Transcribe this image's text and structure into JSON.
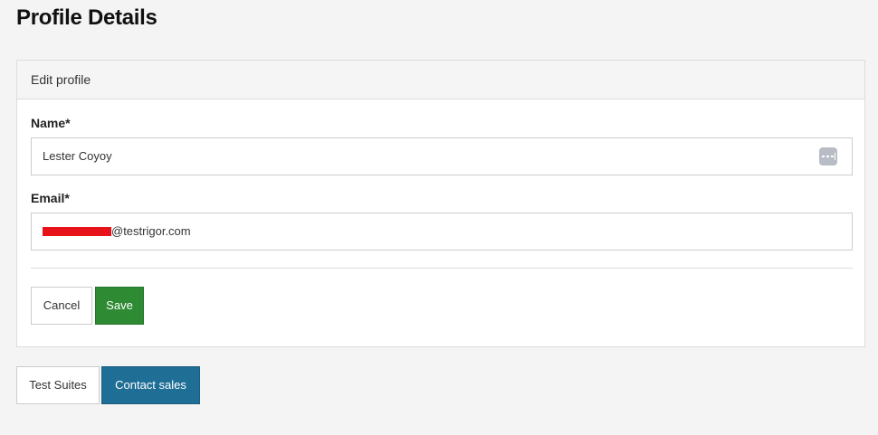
{
  "page": {
    "title": "Profile Details"
  },
  "panel": {
    "header": "Edit profile"
  },
  "form": {
    "name_label": "Name*",
    "name_value": "Lester Coyoy",
    "email_label": "Email*",
    "email_value_visible": "@testrigor.com",
    "email_redacted": true
  },
  "actions": {
    "cancel_label": "Cancel",
    "save_label": "Save"
  },
  "footer": {
    "suites_label": "Test Suites",
    "sales_label": "Contact sales"
  },
  "colors": {
    "save_button": "#2e8b34",
    "contact_sales_button": "#1f6e96",
    "redaction": "#e8121b"
  },
  "icons": {
    "name_field_icon": "password-manager-menu-icon"
  }
}
